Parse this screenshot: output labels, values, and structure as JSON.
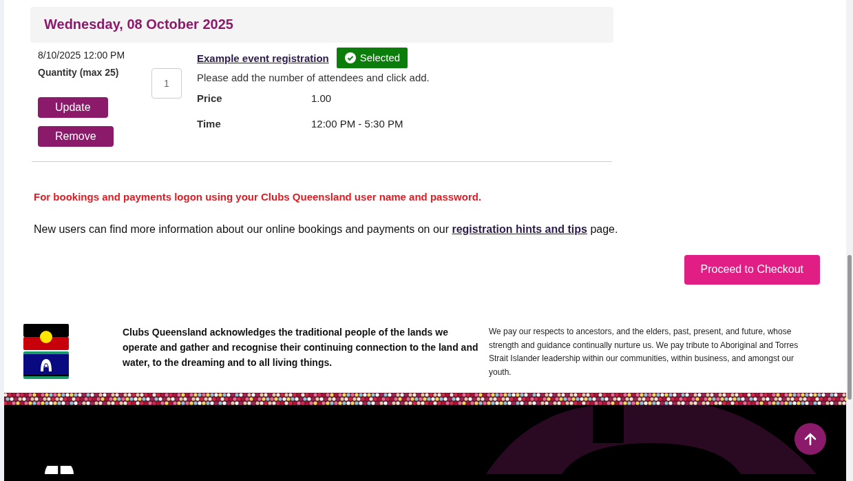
{
  "date_heading": "Wednesday, 08 October 2025",
  "booking": {
    "datetime": "8/10/2025 12:00 PM",
    "quantity_label": "Quantity (max 25)",
    "quantity_value": "1",
    "buttons": [
      "Update",
      "Remove"
    ],
    "event_link": "Example event registration",
    "status": {
      "label": "Selected",
      "selected": true
    },
    "instructions": "Please add the number of attendees and click add.",
    "details": [
      {
        "label": "Price",
        "value": "1.00"
      },
      {
        "label": "Time",
        "value": "12:00 PM - 5:30 PM"
      }
    ]
  },
  "login_notice": "For bookings and payments logon using your Clubs Queensland user name and password.",
  "info": {
    "before": "New users can find more information about our online bookings and payments on our",
    "link": "registration hints and tips",
    "after": "page."
  },
  "checkout_button": "Proceed to Checkout",
  "acknowledgement": {
    "primary": "Clubs Queensland acknowledges the traditional people of the lands we operate and gather and recognise their continuing connection to the land and water, to the dreaming and to all living things.",
    "secondary": "We pay our respects to ancestors, and the elders, past, present, and future, whose strength and guidance continually nurture us. We pay tribute to Aboriginal and Torres Strait Islander leadership within our communities, within business, and amongst our youth."
  }
}
